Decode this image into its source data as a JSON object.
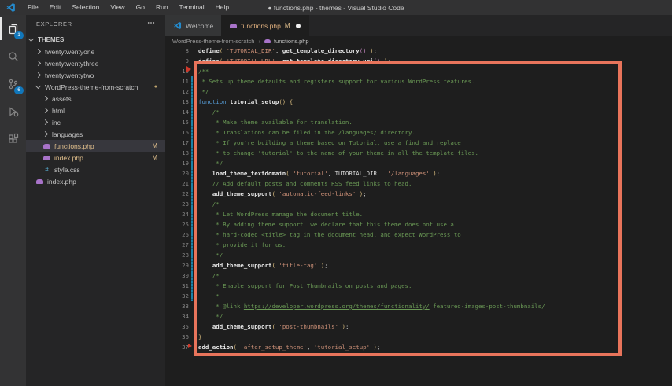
{
  "window": {
    "title": "● functions.php - themes - Visual Studio Code"
  },
  "menu": {
    "items": [
      "File",
      "Edit",
      "Selection",
      "View",
      "Go",
      "Run",
      "Terminal",
      "Help"
    ]
  },
  "activity_bar": {
    "items": [
      {
        "name": "explorer",
        "badge": "1",
        "active": true
      },
      {
        "name": "search",
        "badge": "",
        "active": false
      },
      {
        "name": "source-control",
        "badge": "6",
        "active": false
      },
      {
        "name": "run-and-debug",
        "badge": "",
        "active": false
      },
      {
        "name": "extensions",
        "badge": "",
        "active": false
      }
    ]
  },
  "sidebar": {
    "header": "EXPLORER",
    "more_label": "⋯",
    "tree": [
      {
        "label": "THEMES",
        "kind": "section",
        "chevron": "down",
        "depth": 0
      },
      {
        "label": "twentytwentyone",
        "kind": "folder",
        "chevron": "right",
        "depth": 1
      },
      {
        "label": "twentytwentythree",
        "kind": "folder",
        "chevron": "right",
        "depth": 1
      },
      {
        "label": "twentytwentytwo",
        "kind": "folder",
        "chevron": "right",
        "depth": 1
      },
      {
        "label": "WordPress-theme-from-scratch",
        "kind": "folder",
        "chevron": "down",
        "depth": 1,
        "dot": "●"
      },
      {
        "label": "assets",
        "kind": "folder",
        "chevron": "right",
        "depth": 2
      },
      {
        "label": "html",
        "kind": "folder",
        "chevron": "right",
        "depth": 2
      },
      {
        "label": "inc",
        "kind": "folder",
        "chevron": "right",
        "depth": 2
      },
      {
        "label": "languages",
        "kind": "folder",
        "chevron": "right",
        "depth": 2
      },
      {
        "label": "functions.php",
        "kind": "file",
        "icon": "php",
        "depth": 2,
        "badge": "M",
        "selected": true,
        "modified": true
      },
      {
        "label": "index.php",
        "kind": "file",
        "icon": "php",
        "depth": 2,
        "badge": "M",
        "modified": true
      },
      {
        "label": "style.css",
        "kind": "file",
        "icon": "css",
        "depth": 2
      },
      {
        "label": "index.php",
        "kind": "file",
        "icon": "php",
        "depth": 1
      }
    ]
  },
  "tabs": [
    {
      "label": "Welcome",
      "icon": "vscode-logo",
      "active": false
    },
    {
      "label": "functions.php",
      "icon": "php",
      "git_badge": "M",
      "dirty": true,
      "active": true
    }
  ],
  "breadcrumb": {
    "folder": "WordPress-theme-from-scratch",
    "separator": "›",
    "file": "functions.php"
  },
  "annotation": {
    "type": "highlight-rectangle",
    "color": "#e8745b"
  },
  "editor": {
    "language": "php",
    "git_modified_gutter": {
      "from_line": 14,
      "to_line": 35,
      "color": "#1b81a8"
    },
    "lines": [
      {
        "n": 8,
        "tokens": [
          [
            "fn",
            "define"
          ],
          [
            "p1",
            "("
          ],
          [
            "pl",
            " "
          ],
          [
            "str",
            "'TUTORIAL_DIR'"
          ],
          [
            "pl",
            ", "
          ],
          [
            "fn",
            "get_template_directory"
          ],
          [
            "p2",
            "()"
          ],
          [
            "pl",
            " "
          ],
          [
            "p1",
            ")"
          ],
          [
            "pl",
            ";"
          ]
        ]
      },
      {
        "n": 9,
        "tokens": [
          [
            "fn",
            "define"
          ],
          [
            "p1",
            "("
          ],
          [
            "pl",
            " "
          ],
          [
            "str",
            "'TUTORIAL_URL'"
          ],
          [
            "pl",
            ", "
          ],
          [
            "fn",
            "get_template_directory_uri"
          ],
          [
            "p2",
            "()"
          ],
          [
            "pl",
            " "
          ],
          [
            "p1",
            ")"
          ],
          [
            "pl",
            ";"
          ]
        ]
      },
      {
        "n": 10,
        "tokens": [
          [
            "cmt",
            "/**"
          ]
        ]
      },
      {
        "n": 11,
        "tokens": [
          [
            "cmt",
            " * Sets up theme defaults and registers support for various WordPress features."
          ]
        ]
      },
      {
        "n": 12,
        "tokens": [
          [
            "cmt",
            " */"
          ]
        ]
      },
      {
        "n": 13,
        "tokens": [
          [
            "kw",
            "function"
          ],
          [
            "pl",
            " "
          ],
          [
            "fn",
            "tutorial_setup"
          ],
          [
            "p1",
            "()"
          ],
          [
            "pl",
            " "
          ],
          [
            "p1",
            "{"
          ]
        ]
      },
      {
        "n": 14,
        "tokens": [
          [
            "cmt",
            "    /*"
          ]
        ]
      },
      {
        "n": 15,
        "tokens": [
          [
            "cmt",
            "     * Make theme available for translation."
          ]
        ]
      },
      {
        "n": 16,
        "tokens": [
          [
            "cmt",
            "     * Translations can be filed in the /languages/ directory."
          ]
        ]
      },
      {
        "n": 17,
        "tokens": [
          [
            "cmt",
            "     * If you're building a theme based on Tutorial, use a find and replace"
          ]
        ]
      },
      {
        "n": 18,
        "tokens": [
          [
            "cmt",
            "     * to change 'tutorial' to the name of your theme in all the template files."
          ]
        ]
      },
      {
        "n": 19,
        "tokens": [
          [
            "cmt",
            "     */"
          ]
        ]
      },
      {
        "n": 20,
        "tokens": [
          [
            "pl",
            "    "
          ],
          [
            "fn",
            "load_theme_textdomain"
          ],
          [
            "p1",
            "("
          ],
          [
            "pl",
            " "
          ],
          [
            "str",
            "'tutorial'"
          ],
          [
            "pl",
            ", "
          ],
          [
            "const",
            "TUTORIAL_DIR"
          ],
          [
            "pl",
            " . "
          ],
          [
            "str",
            "'/languages'"
          ],
          [
            "pl",
            " "
          ],
          [
            "p1",
            ")"
          ],
          [
            "pl",
            ";"
          ]
        ]
      },
      {
        "n": 21,
        "tokens": [
          [
            "cmt",
            "    // Add default posts and comments RSS feed links to head."
          ]
        ]
      },
      {
        "n": 22,
        "tokens": [
          [
            "pl",
            "    "
          ],
          [
            "fn",
            "add_theme_support"
          ],
          [
            "p1",
            "("
          ],
          [
            "pl",
            " "
          ],
          [
            "str",
            "'automatic-feed-links'"
          ],
          [
            "pl",
            " "
          ],
          [
            "p1",
            ")"
          ],
          [
            "pl",
            ";"
          ]
        ]
      },
      {
        "n": 23,
        "tokens": [
          [
            "cmt",
            "    /*"
          ]
        ]
      },
      {
        "n": 24,
        "tokens": [
          [
            "cmt",
            "     * Let WordPress manage the document title."
          ]
        ]
      },
      {
        "n": 25,
        "tokens": [
          [
            "cmt",
            "     * By adding theme support, we declare that this theme does not use a"
          ]
        ]
      },
      {
        "n": 26,
        "tokens": [
          [
            "cmt",
            "     * hard-coded <title> tag in the document head, and expect WordPress to"
          ]
        ]
      },
      {
        "n": 27,
        "tokens": [
          [
            "cmt",
            "     * provide it for us."
          ]
        ]
      },
      {
        "n": 28,
        "tokens": [
          [
            "cmt",
            "     */"
          ]
        ]
      },
      {
        "n": 29,
        "tokens": [
          [
            "pl",
            "    "
          ],
          [
            "fn",
            "add_theme_support"
          ],
          [
            "p1",
            "("
          ],
          [
            "pl",
            " "
          ],
          [
            "str",
            "'title-tag'"
          ],
          [
            "pl",
            " "
          ],
          [
            "p1",
            ")"
          ],
          [
            "pl",
            ";"
          ]
        ]
      },
      {
        "n": 30,
        "tokens": [
          [
            "cmt",
            "    /*"
          ]
        ]
      },
      {
        "n": 31,
        "tokens": [
          [
            "cmt",
            "     * Enable support for Post Thumbnails on posts and pages."
          ]
        ]
      },
      {
        "n": 32,
        "tokens": [
          [
            "cmt",
            "     *"
          ]
        ]
      },
      {
        "n": 33,
        "tokens": [
          [
            "cmt",
            "     * @link "
          ],
          [
            "link",
            "https://developer.wordpress.org/themes/functionality/"
          ],
          [
            "cmt",
            " featured-images-post-thumbnails/"
          ]
        ]
      },
      {
        "n": 34,
        "tokens": [
          [
            "cmt",
            "     */"
          ]
        ]
      },
      {
        "n": 35,
        "tokens": [
          [
            "pl",
            "    "
          ],
          [
            "fn",
            "add_theme_support"
          ],
          [
            "p1",
            "("
          ],
          [
            "pl",
            " "
          ],
          [
            "str",
            "'post-thumbnails'"
          ],
          [
            "pl",
            " "
          ],
          [
            "p1",
            ")"
          ],
          [
            "pl",
            ";"
          ]
        ]
      },
      {
        "n": 36,
        "tokens": [
          [
            "p1",
            "}"
          ]
        ]
      },
      {
        "n": 37,
        "tokens": [
          [
            "fn",
            "add_action"
          ],
          [
            "p1",
            "("
          ],
          [
            "pl",
            " "
          ],
          [
            "str",
            "'after_setup_theme'"
          ],
          [
            "pl",
            ", "
          ],
          [
            "str",
            "'tutorial_setup'"
          ],
          [
            "pl",
            " "
          ],
          [
            "p1",
            ")"
          ],
          [
            "pl",
            ";"
          ]
        ]
      }
    ]
  }
}
